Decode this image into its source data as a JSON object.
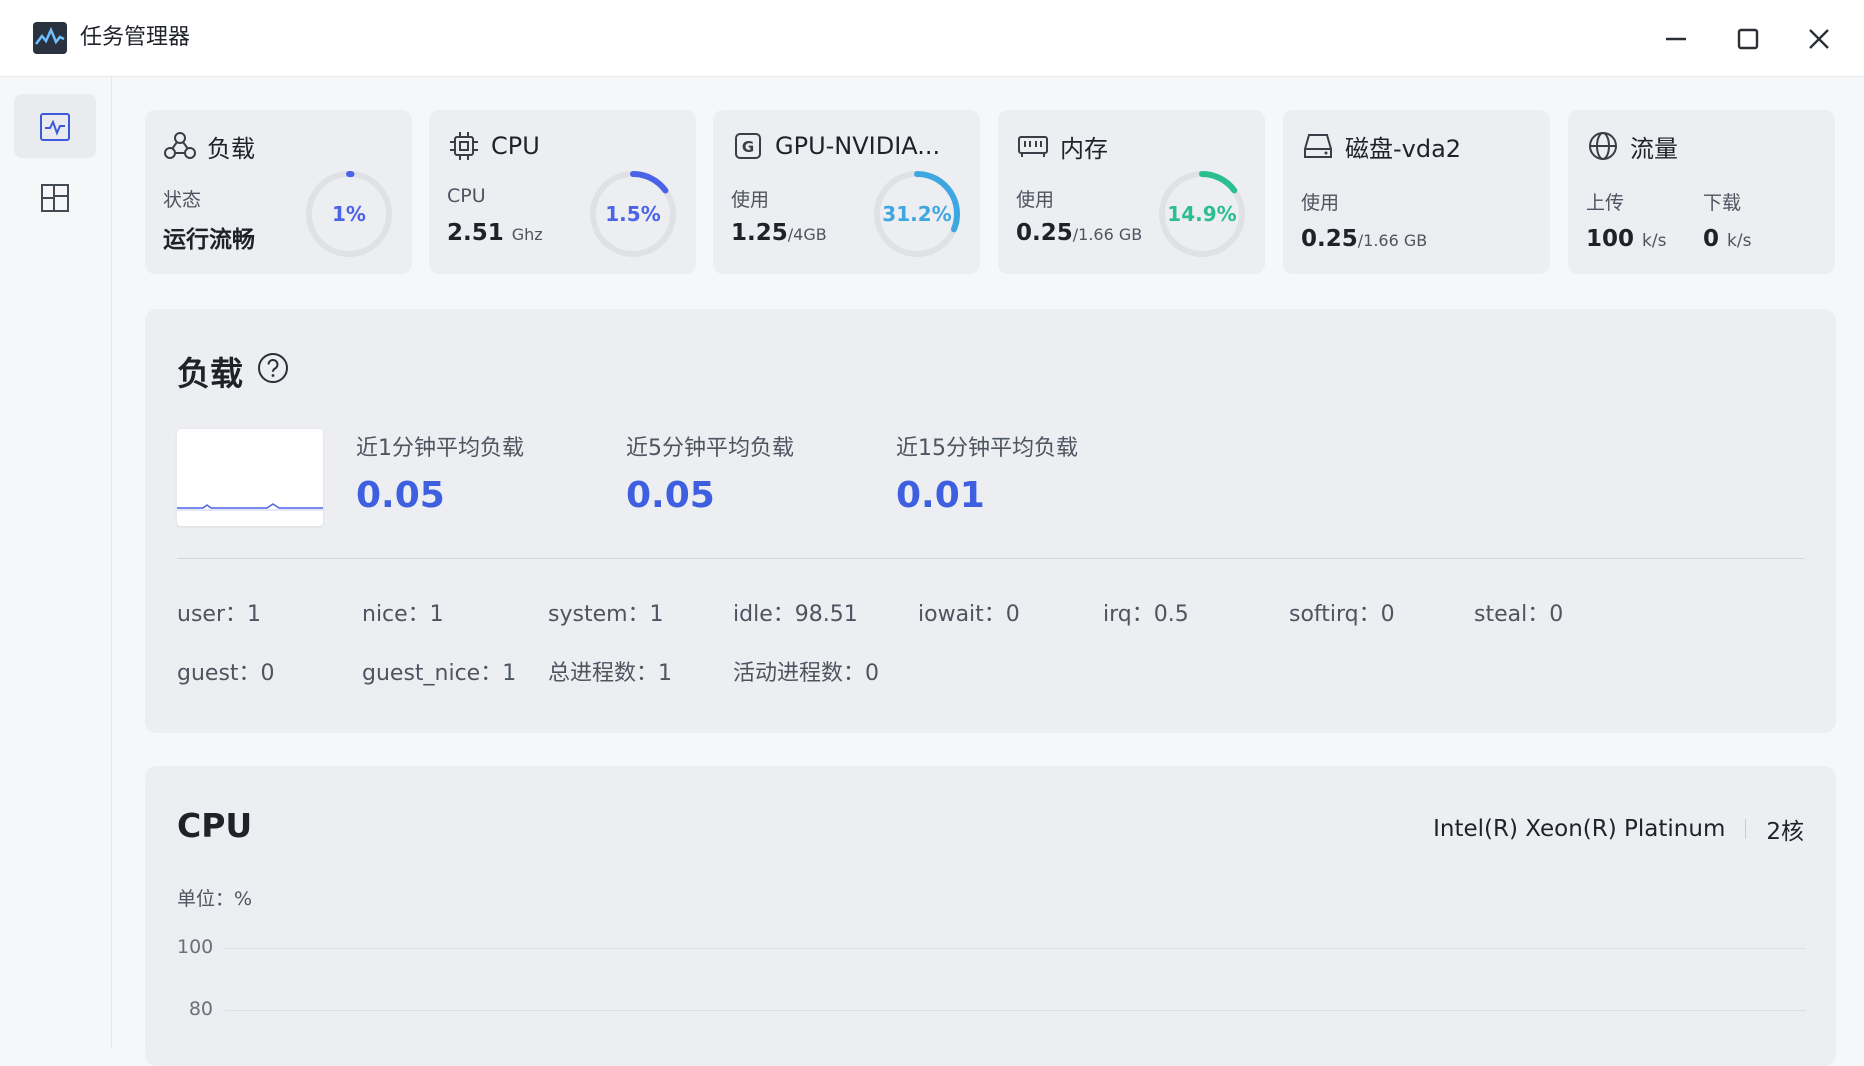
{
  "window": {
    "title": "任务管理器"
  },
  "cards": {
    "load": {
      "title": "负载",
      "label": "状态",
      "value": "运行流畅",
      "percent": "1%",
      "fraction": 0.01,
      "color": "#4b63e6"
    },
    "cpu": {
      "title": "CPU",
      "label": "CPU",
      "value": "2.51",
      "unit": "Ghz",
      "percent": "1.5%",
      "fraction": 0.15,
      "color": "#4b63e6"
    },
    "gpu": {
      "title": "GPU-NVIDIA...",
      "label": "使用",
      "value": "1.25",
      "unit": "/4GB",
      "percent": "31.2%",
      "fraction": 0.312,
      "color": "#3fa7e0"
    },
    "memory": {
      "title": "内存",
      "label": "使用",
      "value": "0.25",
      "unit": "/1.66 GB",
      "percent": "14.9%",
      "fraction": 0.149,
      "color": "#2bbf8e"
    },
    "disk": {
      "title": "磁盘-vda2",
      "label": "使用",
      "value": "0.25",
      "unit": "/1.66 GB"
    },
    "traffic": {
      "title": "流量",
      "upload_label": "上传",
      "upload_value": "100",
      "upload_unit": "k/s",
      "download_label": "下载",
      "download_value": "0",
      "download_unit": "k/s"
    }
  },
  "load_panel": {
    "title": "负载",
    "avg1_label": "近1分钟平均负载",
    "avg1_value": "0.05",
    "avg5_label": "近5分钟平均负载",
    "avg5_value": "0.05",
    "avg15_label": "近15分钟平均负载",
    "avg15_value": "0.01",
    "stats": [
      "user：1",
      "nice：1",
      "system：1",
      "idle：98.51",
      "iowait：0",
      "irq：0.5",
      "softirq：0",
      "steal：0",
      "guest：0",
      "guest_nice：1",
      "总进程数：1",
      "活动进程数：0"
    ]
  },
  "cpu_panel": {
    "title": "CPU",
    "model": "Intel(R) Xeon(R) Platinum",
    "cores": "2核",
    "unit_label": "单位：%",
    "y_ticks": [
      "100",
      "80"
    ]
  },
  "colors": {
    "accent": "#3d5fe0",
    "gpu": "#3fa7e0",
    "memory": "#2bbf8e",
    "panel_bg": "#eceef1"
  }
}
